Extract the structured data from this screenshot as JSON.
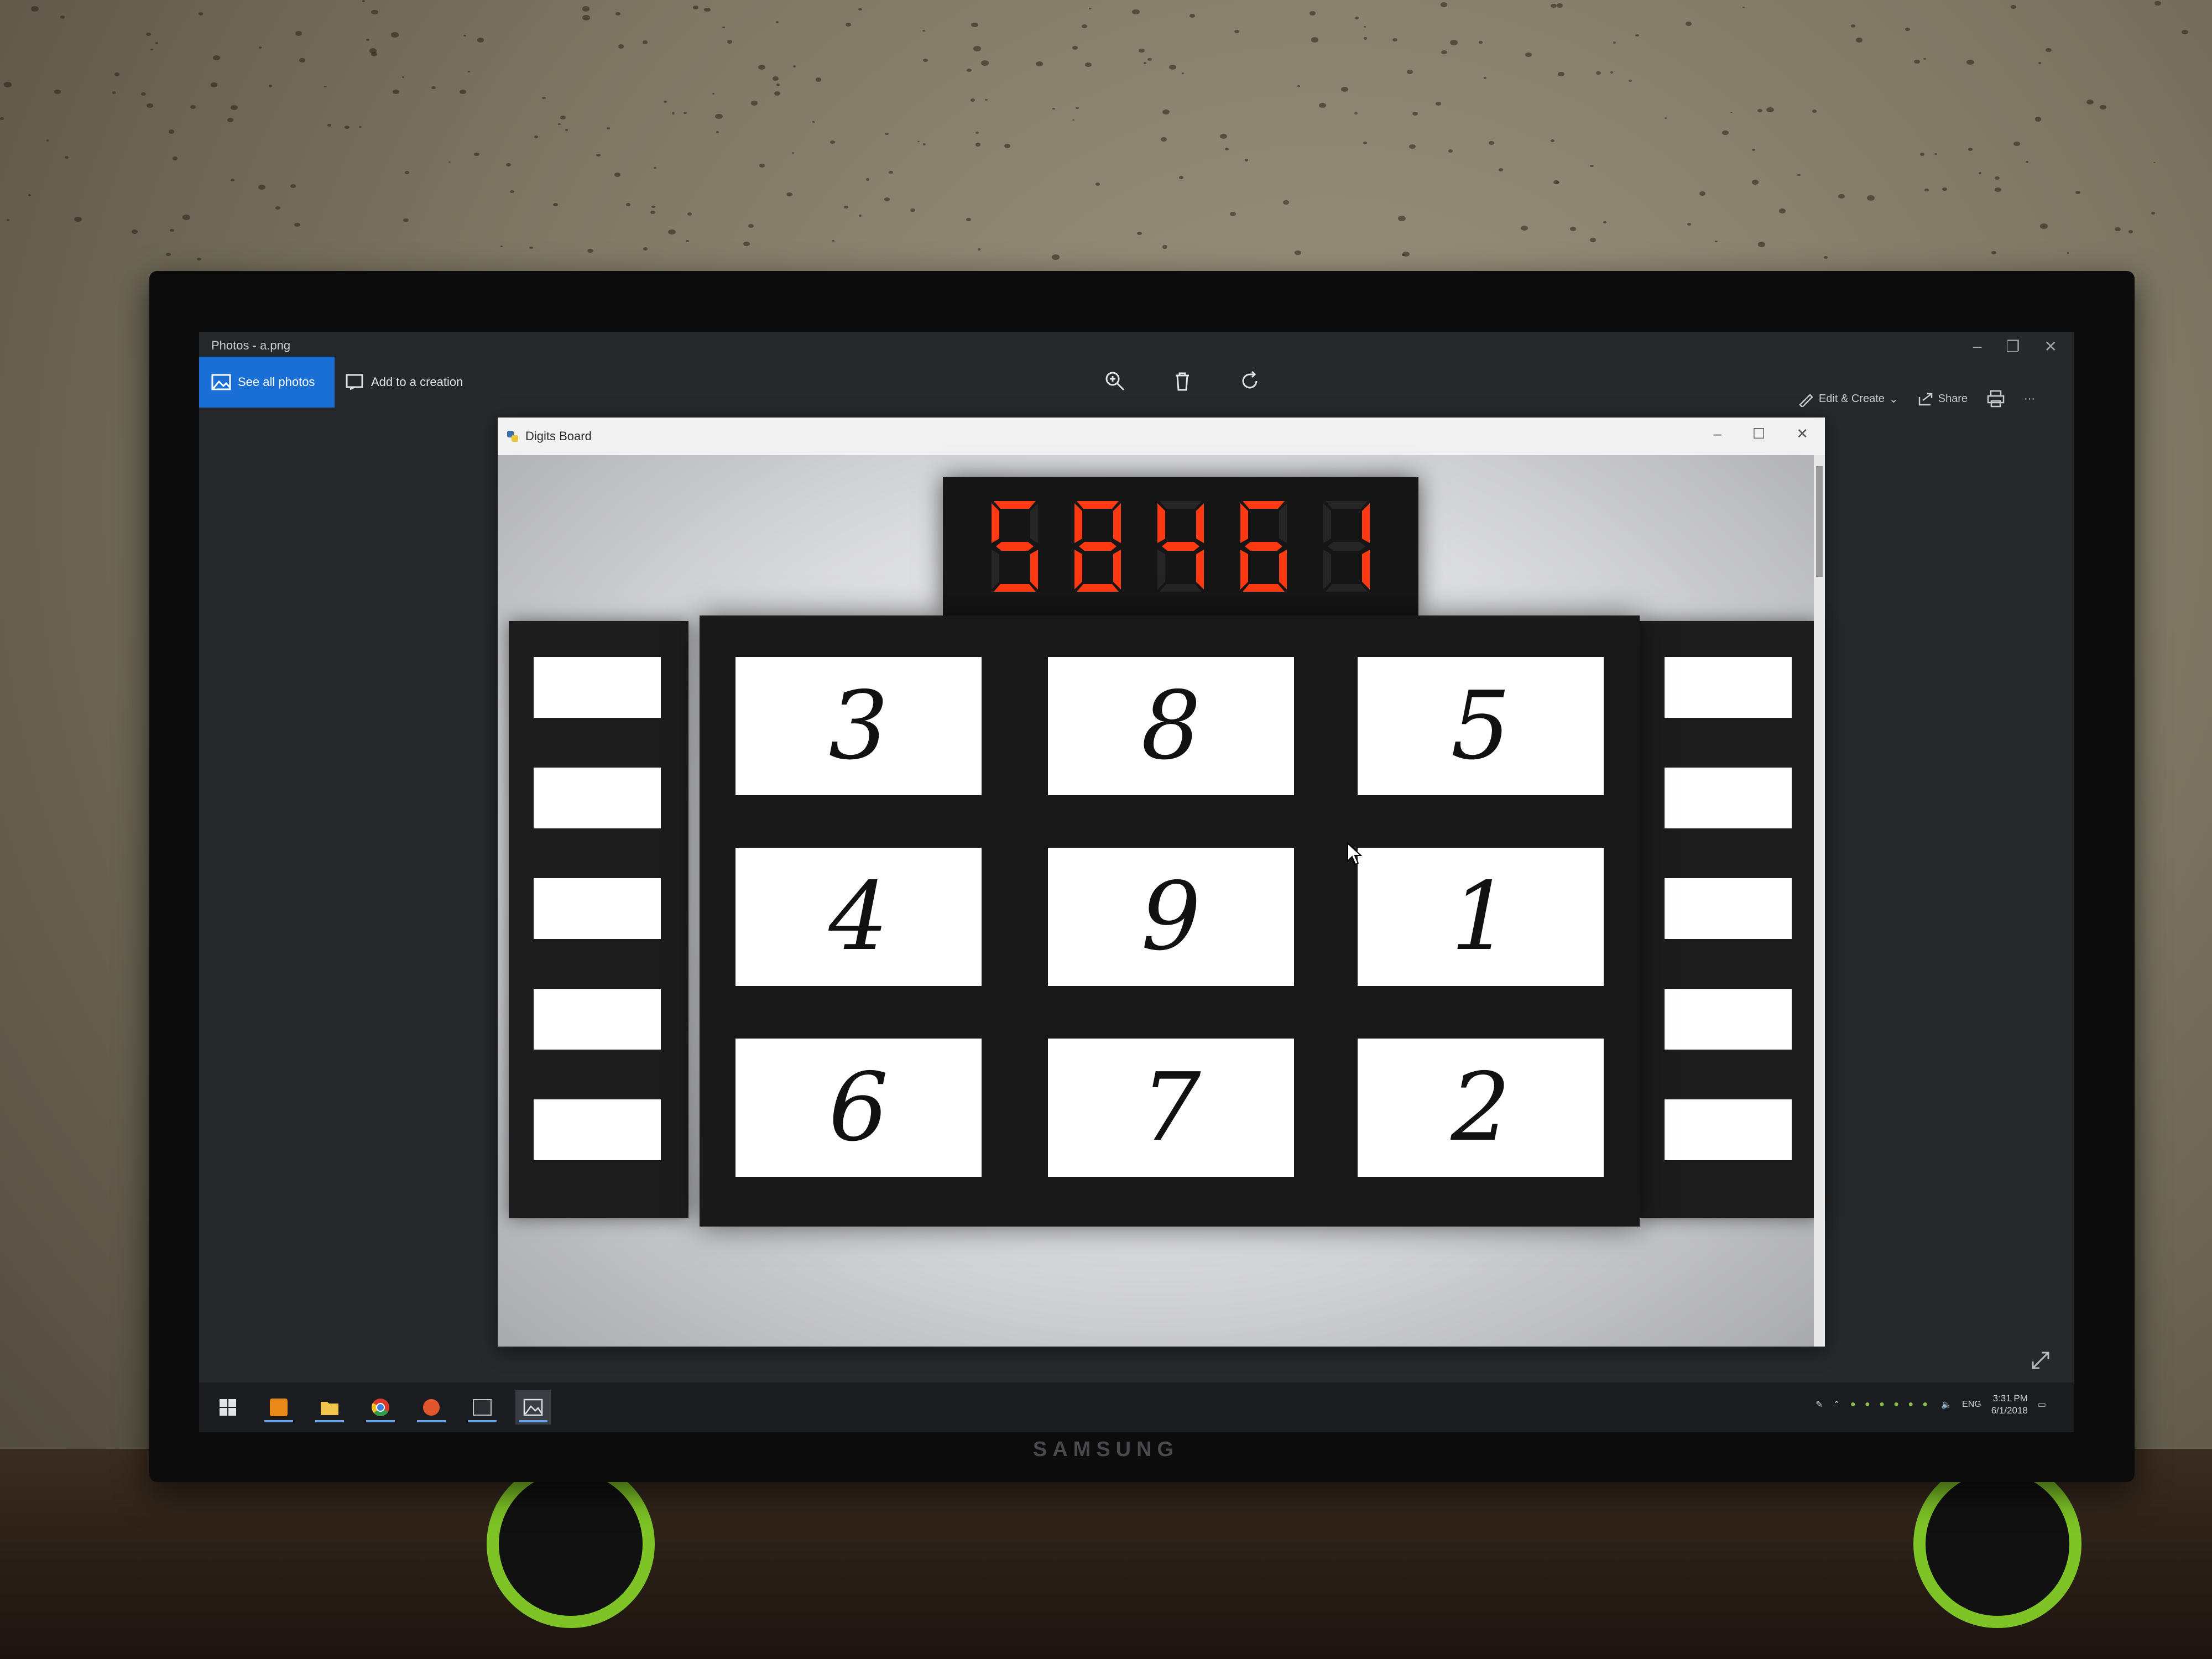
{
  "photos_app": {
    "window_title": "Photos - a.png",
    "see_all_photos": "See all photos",
    "add_to_creation": "Add to a creation",
    "edit_create": "Edit & Create",
    "share": "Share",
    "icons": [
      "zoom-in-icon",
      "delete-icon",
      "rotate-icon",
      "print-icon",
      "more-icon"
    ]
  },
  "digits_window": {
    "title": "Digits Board",
    "counter": "58461",
    "counter_color": "#ff3a12",
    "tiles": [
      "3",
      "8",
      "5",
      "4",
      "9",
      "1",
      "6",
      "7",
      "2"
    ],
    "side_slots_per_panel": 5
  },
  "monitor": {
    "brand": "SAMSUNG"
  },
  "taskbar": {
    "clock_time": "3:31 PM",
    "clock_date": "6/1/2018",
    "lang": "ENG",
    "active_accent": "#6aa6e8"
  }
}
